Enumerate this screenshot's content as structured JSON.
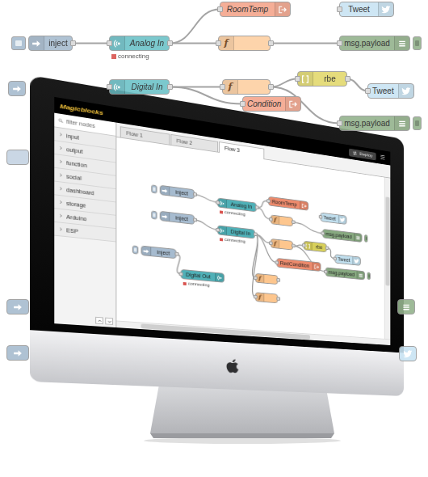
{
  "floating_nodes": [
    {
      "label": "RoomTemp",
      "kind": "output",
      "color": "#f4a58c"
    },
    {
      "label": "Tweet",
      "kind": "tweet",
      "color": "#c9e4f3"
    },
    {
      "label": "inject",
      "kind": "inject",
      "color": "#a6bbcf"
    },
    {
      "label": "Analog In",
      "kind": "arduino",
      "color": "#6cc2c8",
      "status": {
        "text": "connecting",
        "color": "#d9534f"
      }
    },
    {
      "kind": "function",
      "icon": "f",
      "color": "#fdd0a2"
    },
    {
      "label": "msg.payload",
      "kind": "debug",
      "color": "#94b38d"
    },
    {
      "kind": "inject-stub",
      "color": "#a6bbcf"
    },
    {
      "label": "Digital In",
      "kind": "arduino",
      "color": "#6cc2c8"
    },
    {
      "kind": "function",
      "icon": "f",
      "color": "#fdd0a2"
    },
    {
      "label": "rbe",
      "kind": "rbe",
      "color": "#e2d96e"
    },
    {
      "label": "Tweet",
      "kind": "tweet",
      "color": "#c9e4f3"
    },
    {
      "label": "Condition",
      "kind": "output",
      "color": "#f4a58c"
    },
    {
      "label": "msg.payload",
      "kind": "debug",
      "color": "#94b38d"
    },
    {
      "kind": "stub",
      "color": "#c5d3e2"
    },
    {
      "kind": "inject-stub",
      "color": "#a6bbcf"
    },
    {
      "kind": "inject-stub",
      "color": "#a6bbcf"
    },
    {
      "kind": "debug-stub",
      "color": "#94b38d"
    },
    {
      "kind": "tweet-stub",
      "color": "#c9e4f3"
    }
  ],
  "floating_wires": [
    [
      2,
      3
    ],
    [
      3,
      0
    ],
    [
      3,
      4
    ],
    [
      4,
      5
    ],
    [
      7,
      8
    ],
    [
      8,
      9
    ],
    [
      9,
      10
    ],
    [
      8,
      12
    ],
    [
      7,
      11
    ]
  ],
  "screen": {
    "logo": "Magicblocks",
    "deploy": {
      "label": "Deploy"
    },
    "menu": "☰",
    "filter": {
      "placeholder": "filter nodes"
    },
    "categories": [
      {
        "label": "input",
        "expanded": false
      },
      {
        "label": "output",
        "expanded": false
      },
      {
        "label": "function",
        "expanded": false
      },
      {
        "label": "social",
        "expanded": false
      },
      {
        "label": "dashboard",
        "expanded": false
      },
      {
        "label": "storage",
        "expanded": false
      },
      {
        "label": "Arduino",
        "expanded": false
      },
      {
        "label": "ESP",
        "expanded": false
      }
    ],
    "tabs": [
      {
        "label": "Flow 1",
        "selected": false
      },
      {
        "label": "Flow 2",
        "selected": false
      },
      {
        "label": "Flow 3",
        "selected": true
      }
    ],
    "nodes": [
      {
        "label": "inject",
        "kind": "inject",
        "color": "#a6bbcf"
      },
      {
        "label": "Analog In",
        "kind": "arduino",
        "color": "#4fb0b7",
        "status": {
          "text": "connecting",
          "color": "#d9534f"
        }
      },
      {
        "label": "RoomTemp",
        "kind": "output",
        "color": "#ec8a6c"
      },
      {
        "label": "Tweet",
        "kind": "tweet",
        "color": "#c0deed"
      },
      {
        "kind": "function",
        "icon": "f",
        "color": "#fdc68e"
      },
      {
        "label": "msg.payload",
        "kind": "debug",
        "color": "#87a980"
      },
      {
        "label": "inject",
        "kind": "inject",
        "color": "#a6bbcf"
      },
      {
        "label": "Digital In",
        "kind": "arduino",
        "color": "#4fb0b7",
        "status": {
          "text": "connecting",
          "color": "#d9534f"
        }
      },
      {
        "kind": "function",
        "icon": "f",
        "color": "#fdc68e"
      },
      {
        "label": "rbe",
        "kind": "rbe",
        "color": "#d8d05a"
      },
      {
        "label": "Tweet",
        "kind": "tweet",
        "color": "#c0deed"
      },
      {
        "label": "RedCondition",
        "kind": "output",
        "color": "#ec8a6c"
      },
      {
        "label": "msg.payload",
        "kind": "debug",
        "color": "#87a980"
      },
      {
        "label": "inject",
        "kind": "inject",
        "color": "#a6bbcf"
      },
      {
        "label": "Digital Out",
        "kind": "arduino-out",
        "color": "#4fb0b7",
        "status": {
          "text": "connecting",
          "color": "#d9534f"
        }
      },
      {
        "kind": "function",
        "icon": "f",
        "color": "#fdc68e"
      },
      {
        "kind": "function",
        "icon": "f",
        "color": "#fdc68e"
      }
    ],
    "wires": [
      [
        0,
        1
      ],
      [
        1,
        2
      ],
      [
        1,
        4
      ],
      [
        4,
        5
      ],
      [
        6,
        7
      ],
      [
        7,
        8
      ],
      [
        8,
        9
      ],
      [
        9,
        10
      ],
      [
        8,
        12
      ],
      [
        7,
        11
      ],
      [
        7,
        15
      ],
      [
        7,
        16
      ],
      [
        13,
        14
      ]
    ]
  }
}
